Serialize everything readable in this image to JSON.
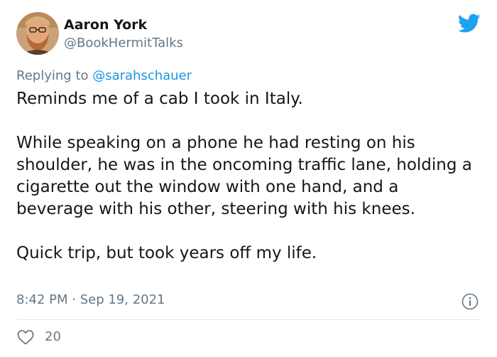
{
  "author": {
    "display_name": "Aaron York",
    "handle": "@BookHermitTalks",
    "avatar_icon": "avatar-photo"
  },
  "reply": {
    "prefix": "Replying to ",
    "mention": "@sarahschauer"
  },
  "body": {
    "paragraph_1": "Reminds me of a cab I took in Italy.",
    "paragraph_2": "While speaking on a phone he had resting on his shoulder, he was in the oncoming traffic lane, holding a cigarette out the window with one hand, and a beverage with his other, steering with his knees.",
    "paragraph_3": "Quick trip, but took years off my life."
  },
  "meta": {
    "time": "8:42 PM",
    "separator": " · ",
    "date": "Sep 19, 2021"
  },
  "actions": {
    "like_count": "20"
  },
  "icons": {
    "brand": "twitter-bird-icon",
    "info": "info-icon",
    "like": "heart-icon"
  },
  "colors": {
    "brand": "#1da1f2",
    "text": "#14171a",
    "secondary": "#657786",
    "link": "#1b95e0",
    "divider": "#e1e8ed"
  }
}
